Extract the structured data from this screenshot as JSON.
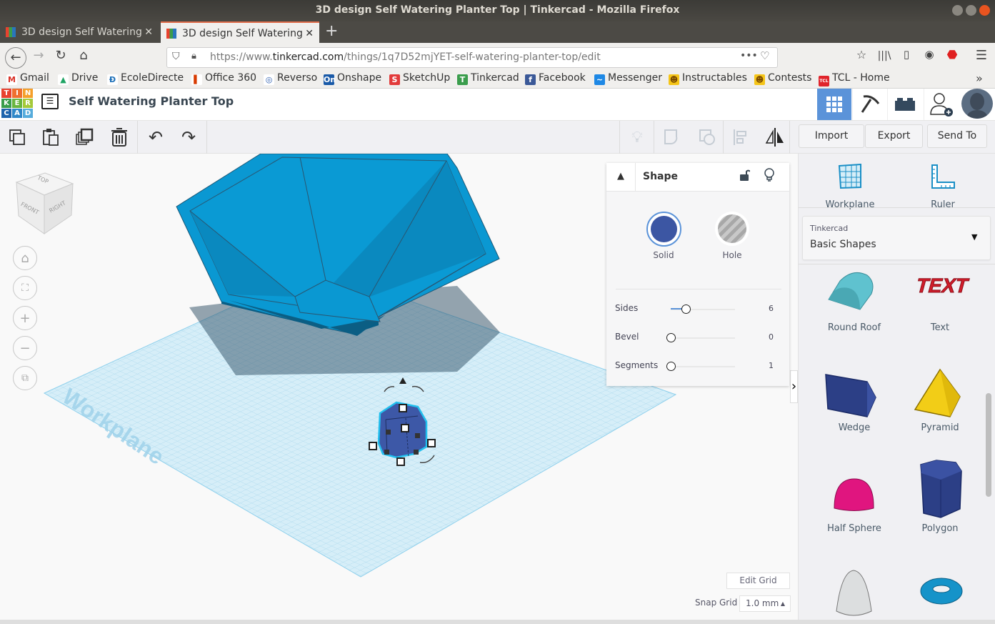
{
  "window": {
    "title": "3D design Self Watering Planter Top | Tinkercad - Mozilla Firefox"
  },
  "tabs": [
    {
      "label": "3D design Self Watering",
      "active": false
    },
    {
      "label": "3D design Self Watering",
      "active": true
    }
  ],
  "new_tab_label": "+",
  "url": {
    "prefix": "https://www.",
    "domain": "tinkercad.com",
    "path": "/things/1q7D52mjYET-self-watering-planter-top/edit"
  },
  "bookmarks": [
    {
      "label": "Gmail",
      "icon": "M",
      "color": "#ffffff",
      "fg": "#d93025"
    },
    {
      "label": "Drive",
      "icon": "▲",
      "color": "#ffffff",
      "fg": "#1fa463"
    },
    {
      "label": "EcoleDirecte",
      "icon": "Ð",
      "color": "#ffffff",
      "fg": "#1c6fb8"
    },
    {
      "label": "Office 360",
      "icon": "▌",
      "color": "#ffffff",
      "fg": "#d83b01"
    },
    {
      "label": "Reverso",
      "icon": "◎",
      "color": "#ffffff",
      "fg": "#2a5db0"
    },
    {
      "label": "Onshape",
      "icon": "On",
      "color": "#1a5aa8",
      "fg": "#ffffff"
    },
    {
      "label": "SketchUp",
      "icon": "S",
      "color": "#e23b3b",
      "fg": "#ffffff"
    },
    {
      "label": "Tinkercad",
      "icon": "T",
      "color": "#3a9d4c",
      "fg": "#ffffff"
    },
    {
      "label": "Facebook",
      "icon": "f",
      "color": "#3b5998",
      "fg": "#ffffff"
    },
    {
      "label": "Messenger",
      "icon": "~",
      "color": "#1e88e5",
      "fg": "#ffffff"
    },
    {
      "label": "Instructables",
      "icon": "☻",
      "color": "#f5c518",
      "fg": "#7a4a00"
    },
    {
      "label": "Contests",
      "icon": "☻",
      "color": "#f5c518",
      "fg": "#7a4a00"
    },
    {
      "label": "TCL - Home",
      "icon": "TCL",
      "color": "#e0242b",
      "fg": "#ffffff"
    }
  ],
  "bookmarks_overflow": "»",
  "app": {
    "logo": [
      "T",
      "I",
      "N",
      "K",
      "E",
      "R",
      "C",
      "A",
      "D"
    ],
    "design_title": "Self Watering Planter Top",
    "header_buttons": [
      "3d-design-view",
      "codeblocks",
      "lego-bricks",
      "invite-user",
      "user-avatar"
    ]
  },
  "toolbar": {
    "import": "Import",
    "export": "Export",
    "send_to": "Send To"
  },
  "viewcube": {
    "top": "TOP",
    "front": "FRONT",
    "right": "RIGHT"
  },
  "workplane_label": "Workplane",
  "inspector": {
    "title": "Shape",
    "solid_label": "Solid",
    "hole_label": "Hole",
    "solid_color": "#3c56a3",
    "params": [
      {
        "label": "Sides",
        "value": "6",
        "fraction": 0.23
      },
      {
        "label": "Bevel",
        "value": "0",
        "fraction": 0
      },
      {
        "label": "Segments",
        "value": "1",
        "fraction": 0
      }
    ]
  },
  "grid": {
    "edit_grid": "Edit Grid",
    "snap_label": "Snap Grid",
    "snap_value": "1.0 mm"
  },
  "panel": {
    "workplane": "Workplane",
    "ruler": "Ruler",
    "library_source": "Tinkercad",
    "library_name": "Basic Shapes",
    "shapes": [
      {
        "label": "Round Roof",
        "color": "#5fc2cf"
      },
      {
        "label": "Text",
        "color": "#d11c2a"
      },
      {
        "label": "Wedge",
        "color": "#2c3f86"
      },
      {
        "label": "Pyramid",
        "color": "#f2cd17"
      },
      {
        "label": "Half Sphere",
        "color": "#e0157f"
      },
      {
        "label": "Polygon",
        "color": "#2c3f86"
      },
      {
        "label": "Paraboloid",
        "color": "#dcdedf"
      },
      {
        "label": "Torus",
        "color": "#1593c9"
      }
    ]
  },
  "collapse_panel": "›"
}
